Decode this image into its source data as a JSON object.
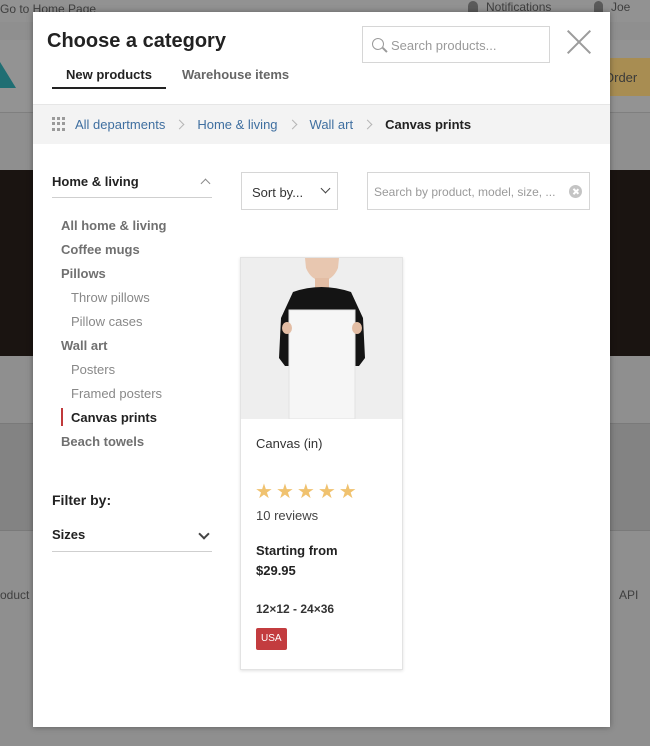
{
  "background": {
    "home_link": "Go to Home Page",
    "notifications": "Notifications",
    "user_name": "Joe",
    "order_label": "Order",
    "footer_left": "oduct",
    "footer_right": "API"
  },
  "modal": {
    "title": "Choose a category",
    "search_placeholder": "Search products...",
    "tabs": [
      {
        "label": "New products",
        "active": true
      },
      {
        "label": "Warehouse items",
        "active": false
      }
    ]
  },
  "breadcrumb": [
    "All departments",
    "Home & living",
    "Wall art",
    "Canvas prints"
  ],
  "sidebar": {
    "department": "Home & living",
    "categories": [
      {
        "label": "All home & living",
        "level": 1
      },
      {
        "label": "Coffee mugs",
        "level": 1
      },
      {
        "label": "Pillows",
        "level": 1
      },
      {
        "label": "Throw pillows",
        "level": 2
      },
      {
        "label": "Pillow cases",
        "level": 2
      },
      {
        "label": "Wall art",
        "level": 1
      },
      {
        "label": "Posters",
        "level": 2
      },
      {
        "label": "Framed posters",
        "level": 2
      },
      {
        "label": "Canvas prints",
        "level": 2,
        "active": true
      },
      {
        "label": "Beach towels",
        "level": 1
      }
    ],
    "filter_label": "Filter by:",
    "filter_sizes": "Sizes"
  },
  "toolbar": {
    "sort_label": "Sort by...",
    "search_placeholder": "Search by product, model, size, ..."
  },
  "product": {
    "name": "Canvas (in)",
    "rating": 5,
    "reviews": "10 reviews",
    "price_label": "Starting from",
    "price": "$29.95",
    "size_range": "12×12 - 24×36",
    "region": "USA"
  },
  "colors": {
    "accent_red": "#c33c3f",
    "link_blue": "#3f6fa0",
    "star": "#f0c26f"
  }
}
